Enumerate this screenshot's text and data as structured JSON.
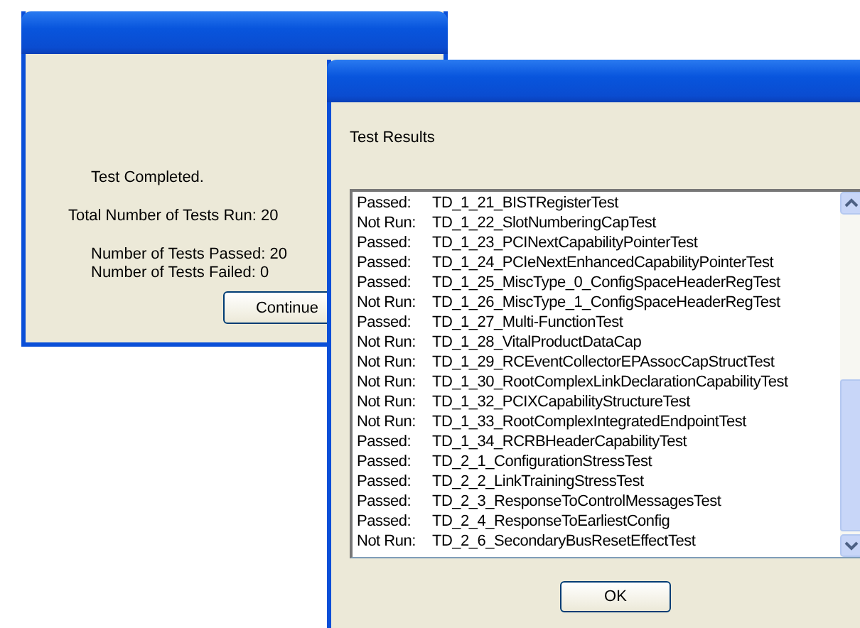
{
  "summary_dialog": {
    "groups": [
      {
        "kind": "indented",
        "lines": [
          "Test Completed."
        ]
      },
      {
        "kind": "plain",
        "lines": [
          "Total Number of Tests Run: 20"
        ]
      },
      {
        "kind": "indented",
        "lines": [
          "Number of Tests Passed: 20",
          "Number of Tests Failed: 0"
        ]
      }
    ],
    "button": "Continue"
  },
  "results_dialog": {
    "label": "Test Results",
    "rows": [
      {
        "status": "Passed:",
        "test": "TD_1_21_BISTRegisterTest"
      },
      {
        "status": "Not Run:",
        "test": "TD_1_22_SlotNumberingCapTest"
      },
      {
        "status": "Passed:",
        "test": "TD_1_23_PCINextCapabilityPointerTest"
      },
      {
        "status": "Passed:",
        "test": "TD_1_24_PCIeNextEnhancedCapabilityPointerTest"
      },
      {
        "status": "Passed:",
        "test": "TD_1_25_MiscType_0_ConfigSpaceHeaderRegTest"
      },
      {
        "status": "Not Run:",
        "test": "TD_1_26_MiscType_1_ConfigSpaceHeaderRegTest"
      },
      {
        "status": "Passed:",
        "test": "TD_1_27_Multi-FunctionTest"
      },
      {
        "status": "Not Run:",
        "test": "TD_1_28_VitalProductDataCap"
      },
      {
        "status": "Not Run:",
        "test": "TD_1_29_RCEventCollectorEPAssocCapStructTest"
      },
      {
        "status": "Not Run:",
        "test": "TD_1_30_RootComplexLinkDeclarationCapabilityTest"
      },
      {
        "status": "Not Run:",
        "test": "TD_1_32_PCIXCapabilityStructureTest"
      },
      {
        "status": "Not Run:",
        "test": "TD_1_33_RootComplexIntegratedEndpointTest"
      },
      {
        "status": "Passed:",
        "test": "TD_1_34_RCRBHeaderCapabilityTest"
      },
      {
        "status": "Passed:",
        "test": "TD_2_1_ConfigurationStressTest"
      },
      {
        "status": "Passed:",
        "test": "TD_2_2_LinkTrainingStressTest"
      },
      {
        "status": "Passed:",
        "test": "TD_2_3_ResponseToControlMessagesTest"
      },
      {
        "status": "Passed:",
        "test": "TD_2_4_ResponseToEarliestConfig"
      },
      {
        "status": "Not Run:",
        "test": "TD_2_6_SecondaryBusResetEffectTest"
      }
    ],
    "button": "OK"
  }
}
